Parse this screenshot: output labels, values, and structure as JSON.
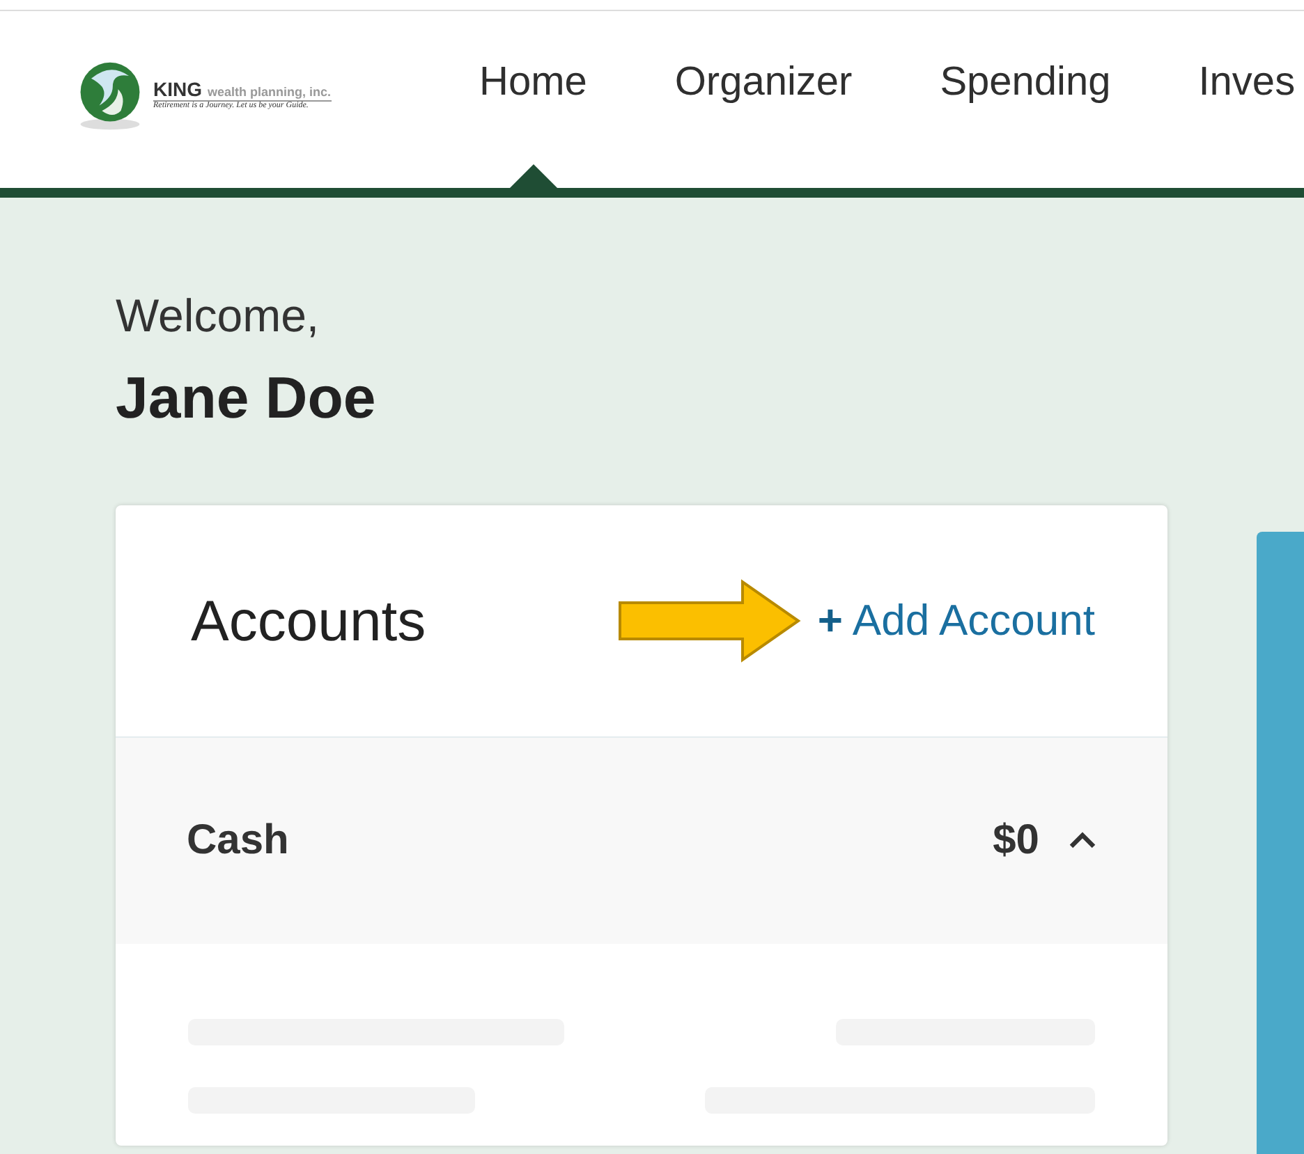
{
  "logo": {
    "name": "KING",
    "tagline": "wealth planning, inc.",
    "slogan": "Retirement is a Journey.  Let us be your Guide."
  },
  "nav": [
    {
      "label": "Home",
      "selected": true
    },
    {
      "label": "Organizer",
      "selected": false
    },
    {
      "label": "Spending",
      "selected": false
    },
    {
      "label": "Inves",
      "selected": false
    }
  ],
  "welcome": {
    "greeting": "Welcome,",
    "name": "Jane Doe"
  },
  "accounts": {
    "title": "Accounts",
    "add_button": {
      "icon": "+",
      "label": "Add Account"
    },
    "groups": [
      {
        "name": "Cash",
        "total": "$0",
        "expanded": true
      }
    ]
  }
}
